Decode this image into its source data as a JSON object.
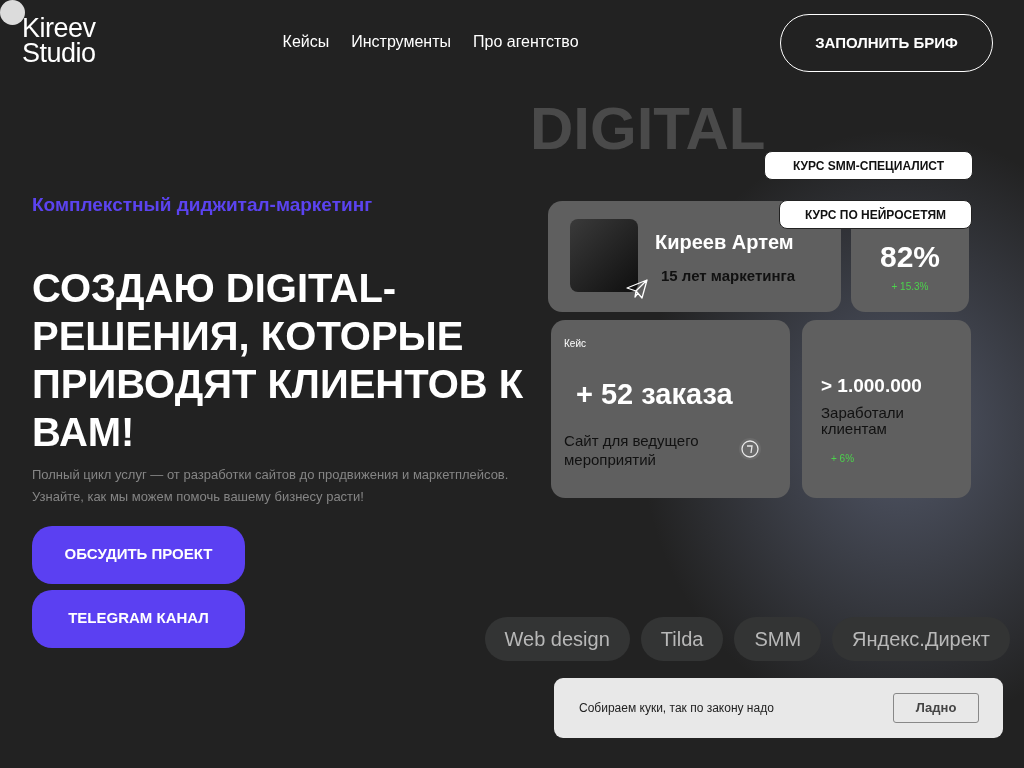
{
  "logo": {
    "line1": "Kireev",
    "line2": "Studio"
  },
  "nav": [
    {
      "label": "Кейсы"
    },
    {
      "label": "Инструменты"
    },
    {
      "label": "Про агентство"
    }
  ],
  "header_button": "ЗАПОЛНИТЬ БРИФ",
  "hero": {
    "eyebrow": "Комплекстный диджитал-маркетинг",
    "title": "СОЗДАЮ DIGITAL-РЕШЕНИЯ, КОТОРЫЕ ПРИВОДЯТ КЛИЕНТОВ К ВАМ!",
    "description": "Полный цикл услуг — от разработки сайтов до продвижения и маркетплейсов. Узнайте, как мы можем помочь вашему бизнесу расти!",
    "buttons": [
      "ОБСУДИТЬ ПРОЕКТ",
      "TELEGRAM КАНАЛ"
    ]
  },
  "background_word": "DIGITAL",
  "course_badges": [
    "КУРС SMM-СПЕЦИАЛИСТ",
    "КУРС ПО НЕЙРОСЕТЯМ"
  ],
  "profile_card": {
    "name": "Киреев Артем",
    "subtitle": "15 лет маркетинга"
  },
  "stat_card": {
    "value": "82%",
    "change": "+ 15.3%"
  },
  "case_card": {
    "label": "Кейс",
    "value": "+ 52 заказа",
    "description": "Сайт для ведущего мероприятий"
  },
  "revenue_card": {
    "value": "> 1.000.000",
    "description": "Заработали клиентам",
    "change": "+ 6%"
  },
  "tags": [
    "Web design",
    "Tilda",
    "SMM",
    "Яндекс.Директ"
  ],
  "cookie_banner": {
    "text": "Собираем куки, так по закону надо",
    "button": "Ладно"
  }
}
